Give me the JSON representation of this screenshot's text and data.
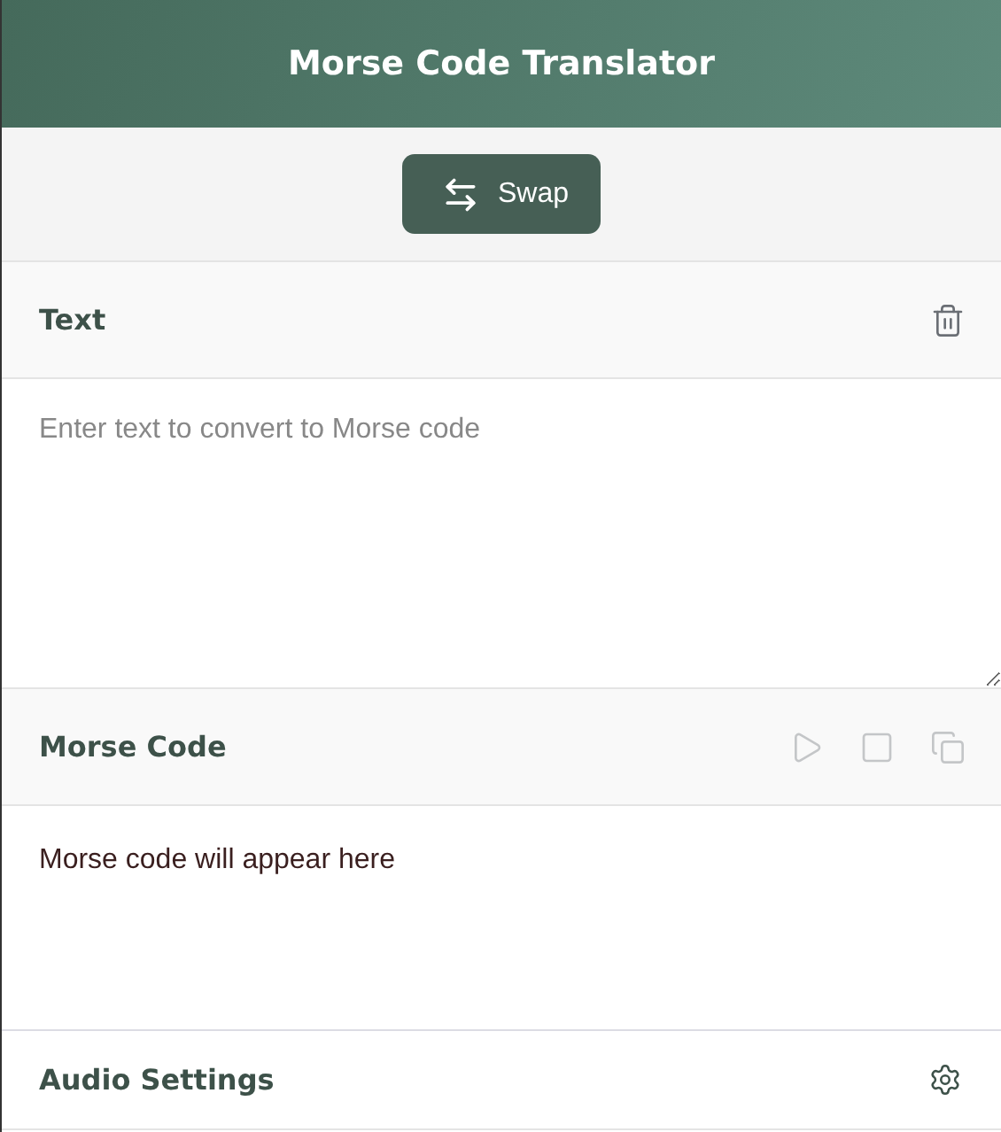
{
  "header": {
    "title": "Morse Code Translator"
  },
  "swap_button": {
    "label": "Swap"
  },
  "text_section": {
    "title": "Text",
    "input": {
      "placeholder": "Enter text to convert to Morse code"
    },
    "actions": [
      {
        "kind": "delete",
        "disabled": false
      }
    ]
  },
  "morse_section": {
    "title": "Morse Code",
    "output": "Morse code will appear here",
    "actions": [
      {
        "kind": "play",
        "disabled": true
      },
      {
        "kind": "stop",
        "disabled": true
      },
      {
        "kind": "copy",
        "disabled": true
      }
    ]
  },
  "audio_settings": {
    "title": "Audio Settings"
  }
}
